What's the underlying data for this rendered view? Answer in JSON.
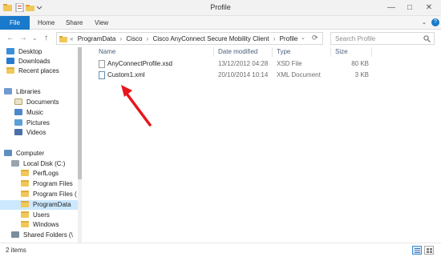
{
  "window": {
    "title": "Profile",
    "minimize": "—",
    "maximize": "□",
    "close": "✕"
  },
  "ribbon": {
    "tabs": [
      "File",
      "Home",
      "Share",
      "View"
    ],
    "help": "?"
  },
  "navigation": {
    "back": "←",
    "forward": "→",
    "up": "↑",
    "expand": "⌄",
    "refresh": "⟳",
    "breadcrumbs": [
      "ProgramData",
      "Cisco",
      "Cisco AnyConnect Secure Mobility Client",
      "Profile"
    ],
    "search_placeholder": "Search Profile"
  },
  "sidebar": {
    "items": [
      {
        "label": "Desktop",
        "icon": "desktop-icon"
      },
      {
        "label": "Downloads",
        "icon": "downloads-icon"
      },
      {
        "label": "Recent places",
        "icon": "recent-places-icon"
      },
      {
        "label": "Libraries",
        "icon": "libraries-icon"
      },
      {
        "label": "Documents",
        "icon": "documents-icon"
      },
      {
        "label": "Music",
        "icon": "music-icon"
      },
      {
        "label": "Pictures",
        "icon": "pictures-icon"
      },
      {
        "label": "Videos",
        "icon": "videos-icon"
      },
      {
        "label": "Computer",
        "icon": "computer-icon"
      },
      {
        "label": "Local Disk (C:)",
        "icon": "disk-icon"
      },
      {
        "label": "PerfLogs",
        "icon": "folder-icon"
      },
      {
        "label": "Program Files",
        "icon": "folder-icon"
      },
      {
        "label": "Program Files (",
        "icon": "folder-icon"
      },
      {
        "label": "ProgramData",
        "icon": "folder-icon"
      },
      {
        "label": "Users",
        "icon": "folder-icon"
      },
      {
        "label": "Windows",
        "icon": "folder-icon"
      },
      {
        "label": "Shared Folders (\\",
        "icon": "network-icon"
      }
    ],
    "selected": "ProgramData"
  },
  "file_list": {
    "columns": [
      "Name",
      "Date modified",
      "Type",
      "Size"
    ],
    "rows": [
      {
        "name": "AnyConnectProfile.xsd",
        "date": "13/12/2012 04:28",
        "type": "XSD File",
        "size": "80 KB"
      },
      {
        "name": "Custom1.xml",
        "date": "20/10/2014 10:14",
        "type": "XML Document",
        "size": "3 KB"
      }
    ]
  },
  "status_bar": {
    "text": "2 items"
  },
  "annotation": {
    "arrow_color": "#e8161b"
  }
}
